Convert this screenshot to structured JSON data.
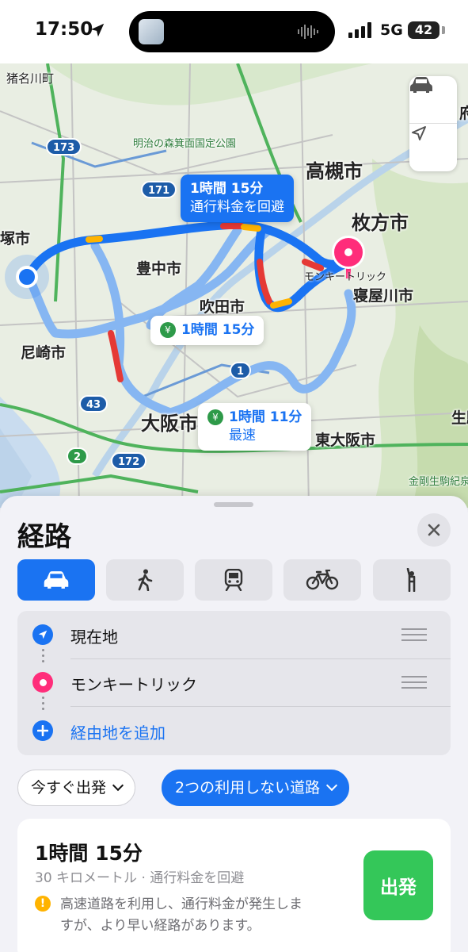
{
  "status_bar": {
    "time": "17:50",
    "network": "5G",
    "battery": "42"
  },
  "map": {
    "places": {
      "inagawa": "猪名川町",
      "forest_park": "明治の森箕面国定公園",
      "takatsuki": "高槻市",
      "hirakata": "枚方市",
      "takarazuka": "塚市",
      "toyonaka": "豊中市",
      "suita": "吹田市",
      "amagasaki": "尼崎市",
      "neyagawa": "寝屋川市",
      "osaka": "大阪市",
      "higashiosaka": "東大阪市",
      "kongo_park": "金剛生駒紀泉",
      "ikoma": "生駒",
      "fu": "府"
    },
    "highway_shields": [
      "173",
      "171",
      "43",
      "2",
      "172",
      "1"
    ],
    "destination_label": "モンキートリック",
    "route_callouts": [
      {
        "time": "1時間 15分",
        "note": "通行料金を回避"
      },
      {
        "time": "1時間 15分",
        "toll_icon": "¥"
      },
      {
        "time": "1時間 11分",
        "note": "最速",
        "toll_icon": "¥"
      }
    ]
  },
  "sheet": {
    "title": "経路",
    "transport_modes": [
      "car-icon",
      "walk-icon",
      "transit-icon",
      "bike-icon",
      "rideshare-icon"
    ],
    "waypoints": {
      "origin": "現在地",
      "destination": "モンキートリック",
      "add_stop": "経由地を追加"
    },
    "depart_chip": "今すぐ出発",
    "avoid_chip": "2つの利用しない道路",
    "route_card": {
      "time": "1時間 15分",
      "meta": "30 キロメートル · 通行料金を回避",
      "warning": "高速道路を利用し、通行料金が発生しますが、より早い経路があります。",
      "go_label": "出発"
    }
  },
  "colors": {
    "accent": "#1a73f2",
    "destination": "#ff2d7a",
    "go": "#34c759",
    "warning": "#ffb300"
  }
}
